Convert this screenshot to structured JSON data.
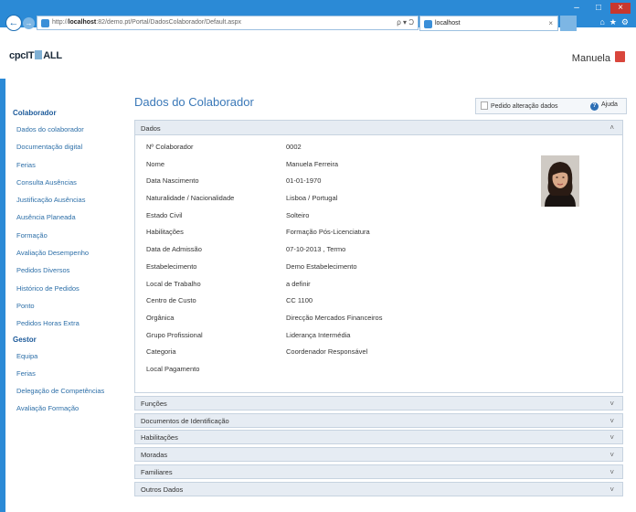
{
  "browser": {
    "url_prefix": "http://",
    "url_host": "localhost",
    "url_rest": ":82/demo.pt/Portal/DadosColaborador/Default.aspx",
    "url_tools": "ρ ▾ Ɔ",
    "tab_title": "localhost",
    "tab_close": "×",
    "window_controls": [
      "–",
      "□",
      "×"
    ],
    "toolbar_icons": [
      "⌂",
      "★",
      "⚙"
    ],
    "back_glyph": "←",
    "forward_glyph": "→",
    "accent": "#2b8ad6"
  },
  "app": {
    "logo_left": "cpc",
    "logo_right": "IT",
    "logo_end": "ALL",
    "user_name": "Manuela"
  },
  "sidebar": {
    "group1": "Colaborador",
    "items1": [
      "Dados do colaborador",
      "Documentação digital",
      "Ferias",
      "Consulta Ausências",
      "Justificação Ausências",
      "Ausência Planeada",
      "Formação",
      "Avaliação Desempenho",
      "Pedidos Diversos",
      "Histórico de Pedidos",
      "Ponto",
      "Pedidos Horas Extra"
    ],
    "group2": "Gestor",
    "items2": [
      "Equipa",
      "Ferias",
      "Delegação de Competências",
      "Avaliação Formação"
    ]
  },
  "main": {
    "title": "Dados do Colaborador",
    "request_button": "Pedido alteração dados",
    "help_button": "Ajuda",
    "panel_title": "Dados",
    "chevron_up": "˄",
    "chevron_down": "˅",
    "fields": [
      {
        "label": "Nº Colaborador",
        "value": "0002"
      },
      {
        "label": "Nome",
        "value": "Manuela Ferreira"
      },
      {
        "label": "Data Nascimento",
        "value": "01-01-1970"
      },
      {
        "label": "Naturalidade / Nacionalidade",
        "value": "Lisboa / Portugal"
      },
      {
        "label": "Estado Civil",
        "value": "Solteiro"
      },
      {
        "label": "Habilitações",
        "value": "Formação Pós-Licenciatura"
      },
      {
        "label": "Data de Admissão",
        "value": "07-10-2013 , Termo"
      },
      {
        "label": "Estabelecimento",
        "value": "Demo Estabelecimento"
      },
      {
        "label": "Local de Trabalho",
        "value": "a definir"
      },
      {
        "label": "Centro de Custo",
        "value": "CC 1100"
      },
      {
        "label": "Orgânica",
        "value": "Direcção Mercados Financeiros"
      },
      {
        "label": "Grupo Profissional",
        "value": "Liderança Intermédia"
      },
      {
        "label": "Categoria",
        "value": "Coordenador Responsável"
      },
      {
        "label": "Local Pagamento",
        "value": ""
      }
    ],
    "sections": [
      "Funções",
      "Documentos de Identificação",
      "Habilitações",
      "Moradas",
      "Familiares",
      "Outros Dados"
    ]
  }
}
